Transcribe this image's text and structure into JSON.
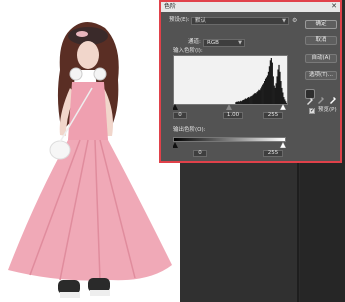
{
  "dialog": {
    "title": "色阶",
    "close": "✕",
    "preset_label": "预设(E):",
    "preset_value": "默认",
    "channel_label": "通道:",
    "channel_value": "RGB",
    "input_levels_label": "输入色阶(I):",
    "input_black": "0",
    "input_gamma": "1.00",
    "input_white": "255",
    "output_levels_label": "输出色阶(O):",
    "output_black": "0",
    "output_white": "255",
    "buttons": {
      "ok": "确定",
      "cancel": "取消",
      "auto": "自动(A)",
      "options": "选项(T)..."
    },
    "preview_label": "预览(P)",
    "preview_checked": true
  },
  "histogram": [
    0,
    0,
    0,
    0,
    0,
    0,
    0,
    0,
    0,
    0,
    0,
    0,
    0,
    0,
    0,
    0,
    0,
    0,
    0,
    0,
    0,
    0,
    0,
    0,
    0,
    0,
    0,
    0,
    0,
    0,
    0,
    0,
    0,
    0,
    0,
    0,
    0,
    0,
    0,
    0,
    0,
    0,
    0,
    0,
    0,
    0,
    0,
    0,
    0,
    0,
    0,
    0,
    0,
    0,
    0,
    0,
    0,
    0,
    0,
    0,
    0,
    0,
    0,
    0,
    0.04,
    0.05,
    0.05,
    0.06,
    0.05,
    0.07,
    0.06,
    0.08,
    0.09,
    0.1,
    0.12,
    0.11,
    0.13,
    0.15,
    0.14,
    0.16,
    0.17,
    0.18,
    0.2,
    0.22,
    0.24,
    0.23,
    0.26,
    0.28,
    0.31,
    0.3,
    0.34,
    0.38,
    0.42,
    0.45,
    0.5,
    0.55,
    0.58,
    0.62,
    0.7,
    0.82,
    0.95,
    1.0,
    0.9,
    0.6,
    0.4,
    0.35,
    0.45,
    0.6,
    0.75,
    0.85,
    0.7,
    0.5,
    0.35,
    0.25,
    0.15,
    0.1,
    0.06,
    0.02
  ]
}
